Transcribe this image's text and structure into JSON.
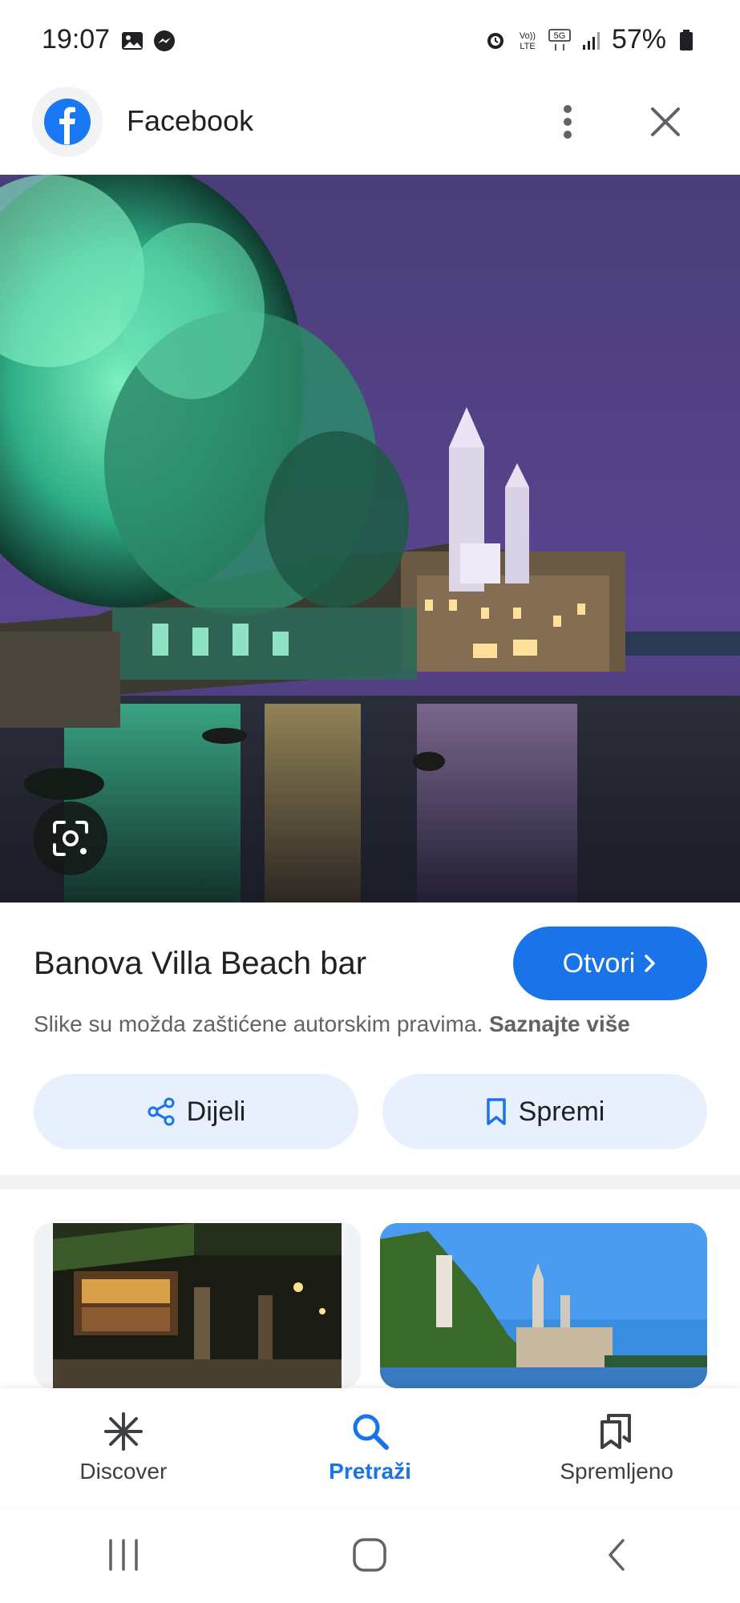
{
  "status_bar": {
    "time": "19:07",
    "battery": "57%",
    "icons": [
      "gallery-icon",
      "messenger-icon",
      "alarm-icon",
      "volte-icon",
      "5g-icon",
      "signal-icon",
      "battery-icon"
    ]
  },
  "header": {
    "source": "Facebook",
    "source_icon": "facebook-icon"
  },
  "result": {
    "title": "Banova Villa Beach bar",
    "open_label": "Otvori",
    "copyright_text": "Slike su možda zaštićene autorskim pravima.",
    "learn_more": "Saznajte više"
  },
  "actions": {
    "share_label": "Dijeli",
    "save_label": "Spremi"
  },
  "bottom_nav": {
    "items": [
      {
        "label": "Discover",
        "icon": "discover-icon",
        "active": false
      },
      {
        "label": "Pretraži",
        "icon": "search-icon",
        "active": true
      },
      {
        "label": "Spremljeno",
        "icon": "saved-icon",
        "active": false
      }
    ]
  },
  "colors": {
    "accent": "#1a73e8",
    "pill_bg": "#e8f0fe",
    "facebook": "#1877f2"
  }
}
